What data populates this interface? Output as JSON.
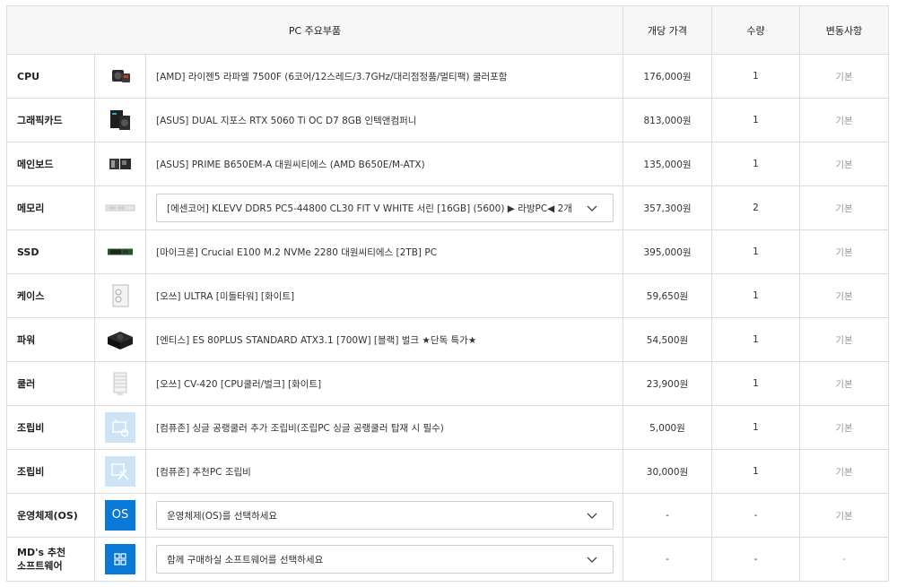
{
  "header": {
    "parts": "PC 주요부품",
    "unit_price": "개당 가격",
    "quantity": "수량",
    "changes": "변동사항"
  },
  "rows": [
    {
      "category": "CPU",
      "icon": "cpu-cooler-icon",
      "name": "[AMD] 라이젠5 라파엘 7500F (6코어/12스레드/3.7GHz/대리점정품/멀티팩) 쿨러포함",
      "price": "176,000원",
      "qty": "1",
      "status": "기본"
    },
    {
      "category": "그래픽카드",
      "icon": "graphics-card-icon",
      "name": "[ASUS] DUAL 지포스 RTX 5060 Ti OC D7 8GB 인텍앤컴퍼니",
      "price": "813,000원",
      "qty": "1",
      "status": "기본"
    },
    {
      "category": "메인보드",
      "icon": "motherboard-icon",
      "name": "[ASUS] PRIME B650EM-A 대원씨티에스 (AMD B650E/M-ATX)",
      "price": "135,000원",
      "qty": "1",
      "status": "기본"
    },
    {
      "category": "메모리",
      "icon": "memory-module-icon",
      "name": "[에센코어] KLEVV DDR5 PC5-44800 CL30 FIT V WHITE 서린 [16GB] (5600) ▶ 라방PC◀ 2개",
      "price": "357,300원",
      "qty": "2",
      "status": "기본",
      "select": true
    },
    {
      "category": "SSD",
      "icon": "ssd-icon",
      "name": "[마이크론] Crucial E100 M.2 NVMe 2280 대원씨티에스 [2TB] PC",
      "price": "395,000원",
      "qty": "1",
      "status": "기본"
    },
    {
      "category": "케이스",
      "icon": "case-icon",
      "name": "[오쓰] ULTRA [미들타워] [화이트]",
      "price": "59,650원",
      "qty": "1",
      "status": "기본"
    },
    {
      "category": "파워",
      "icon": "power-supply-icon",
      "name": "[엔티스] ES 80PLUS STANDARD ATX3.1 [700W] [블랙] 벌크 ★단독 특가★",
      "price": "54,500원",
      "qty": "1",
      "status": "기본"
    },
    {
      "category": "쿨러",
      "icon": "cpu-air-cooler-icon",
      "name": "[오쓰] CV-420 [CPU쿨러/벌크] [화이트]",
      "price": "23,900원",
      "qty": "1",
      "status": "기본"
    },
    {
      "category": "조립비",
      "icon": "assembly-service-icon",
      "name": "[컴퓨존] 싱글 공랭쿨러 추가 조립비(조립PC 싱글 공랭쿨러 탑재 시 필수)",
      "price": "5,000원",
      "qty": "1",
      "status": "기본"
    },
    {
      "category": "조립비",
      "icon": "assembly-tools-icon",
      "name": "[컴퓨존] 추천PC 조립비",
      "price": "30,000원",
      "qty": "1",
      "status": "기본"
    },
    {
      "category": "운영체제(OS)",
      "icon": "os-icon",
      "icon_text": "OS",
      "name": "운영체제(OS)를 선택하세요",
      "price": "-",
      "qty": "-",
      "status": "기본",
      "select": true
    },
    {
      "category": "MD's 추천 소프트웨어",
      "category_line1": "MD's 추천",
      "category_line2": "소프트웨어",
      "icon": "software-icon",
      "name": "함께 구매하실 소프트웨어를 선택하세요",
      "price": "-",
      "qty": "-",
      "status": "-",
      "select": true
    }
  ]
}
